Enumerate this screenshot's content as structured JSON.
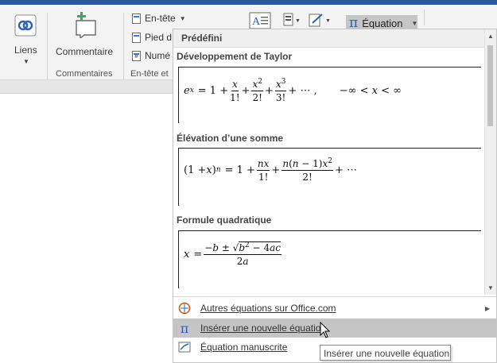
{
  "ribbon": {
    "links_label": "Liens",
    "comment_label": "Commentaire",
    "comments_group_label": "Commentaires",
    "header_label": "En-tête",
    "footer_label": "Pied d",
    "page_number_label": "Numé",
    "header_footer_group_label": "En-tête et",
    "equation_label": "Équation"
  },
  "equation_panel": {
    "header": "Prédéfini",
    "items": [
      {
        "title": "Développement de Taylor"
      },
      {
        "title": "Élévation d’une somme"
      },
      {
        "title": "Formule quadratique"
      }
    ],
    "menu": [
      {
        "label": "Autres équations sur Office.com",
        "icon": "office-equations-icon",
        "has_submenu": true
      },
      {
        "label": "Insérer une nouvelle équation",
        "icon": "pi-icon",
        "hovered": true
      },
      {
        "label": "Équation manuscrite",
        "icon": "ink-equation-icon"
      }
    ]
  },
  "tooltip": "Insérer une nouvelle équation",
  "colors": {
    "ribbon_blue": "#2b579a",
    "hover_gray": "#c5c5c5",
    "pi_blue": "#2e63b6"
  }
}
